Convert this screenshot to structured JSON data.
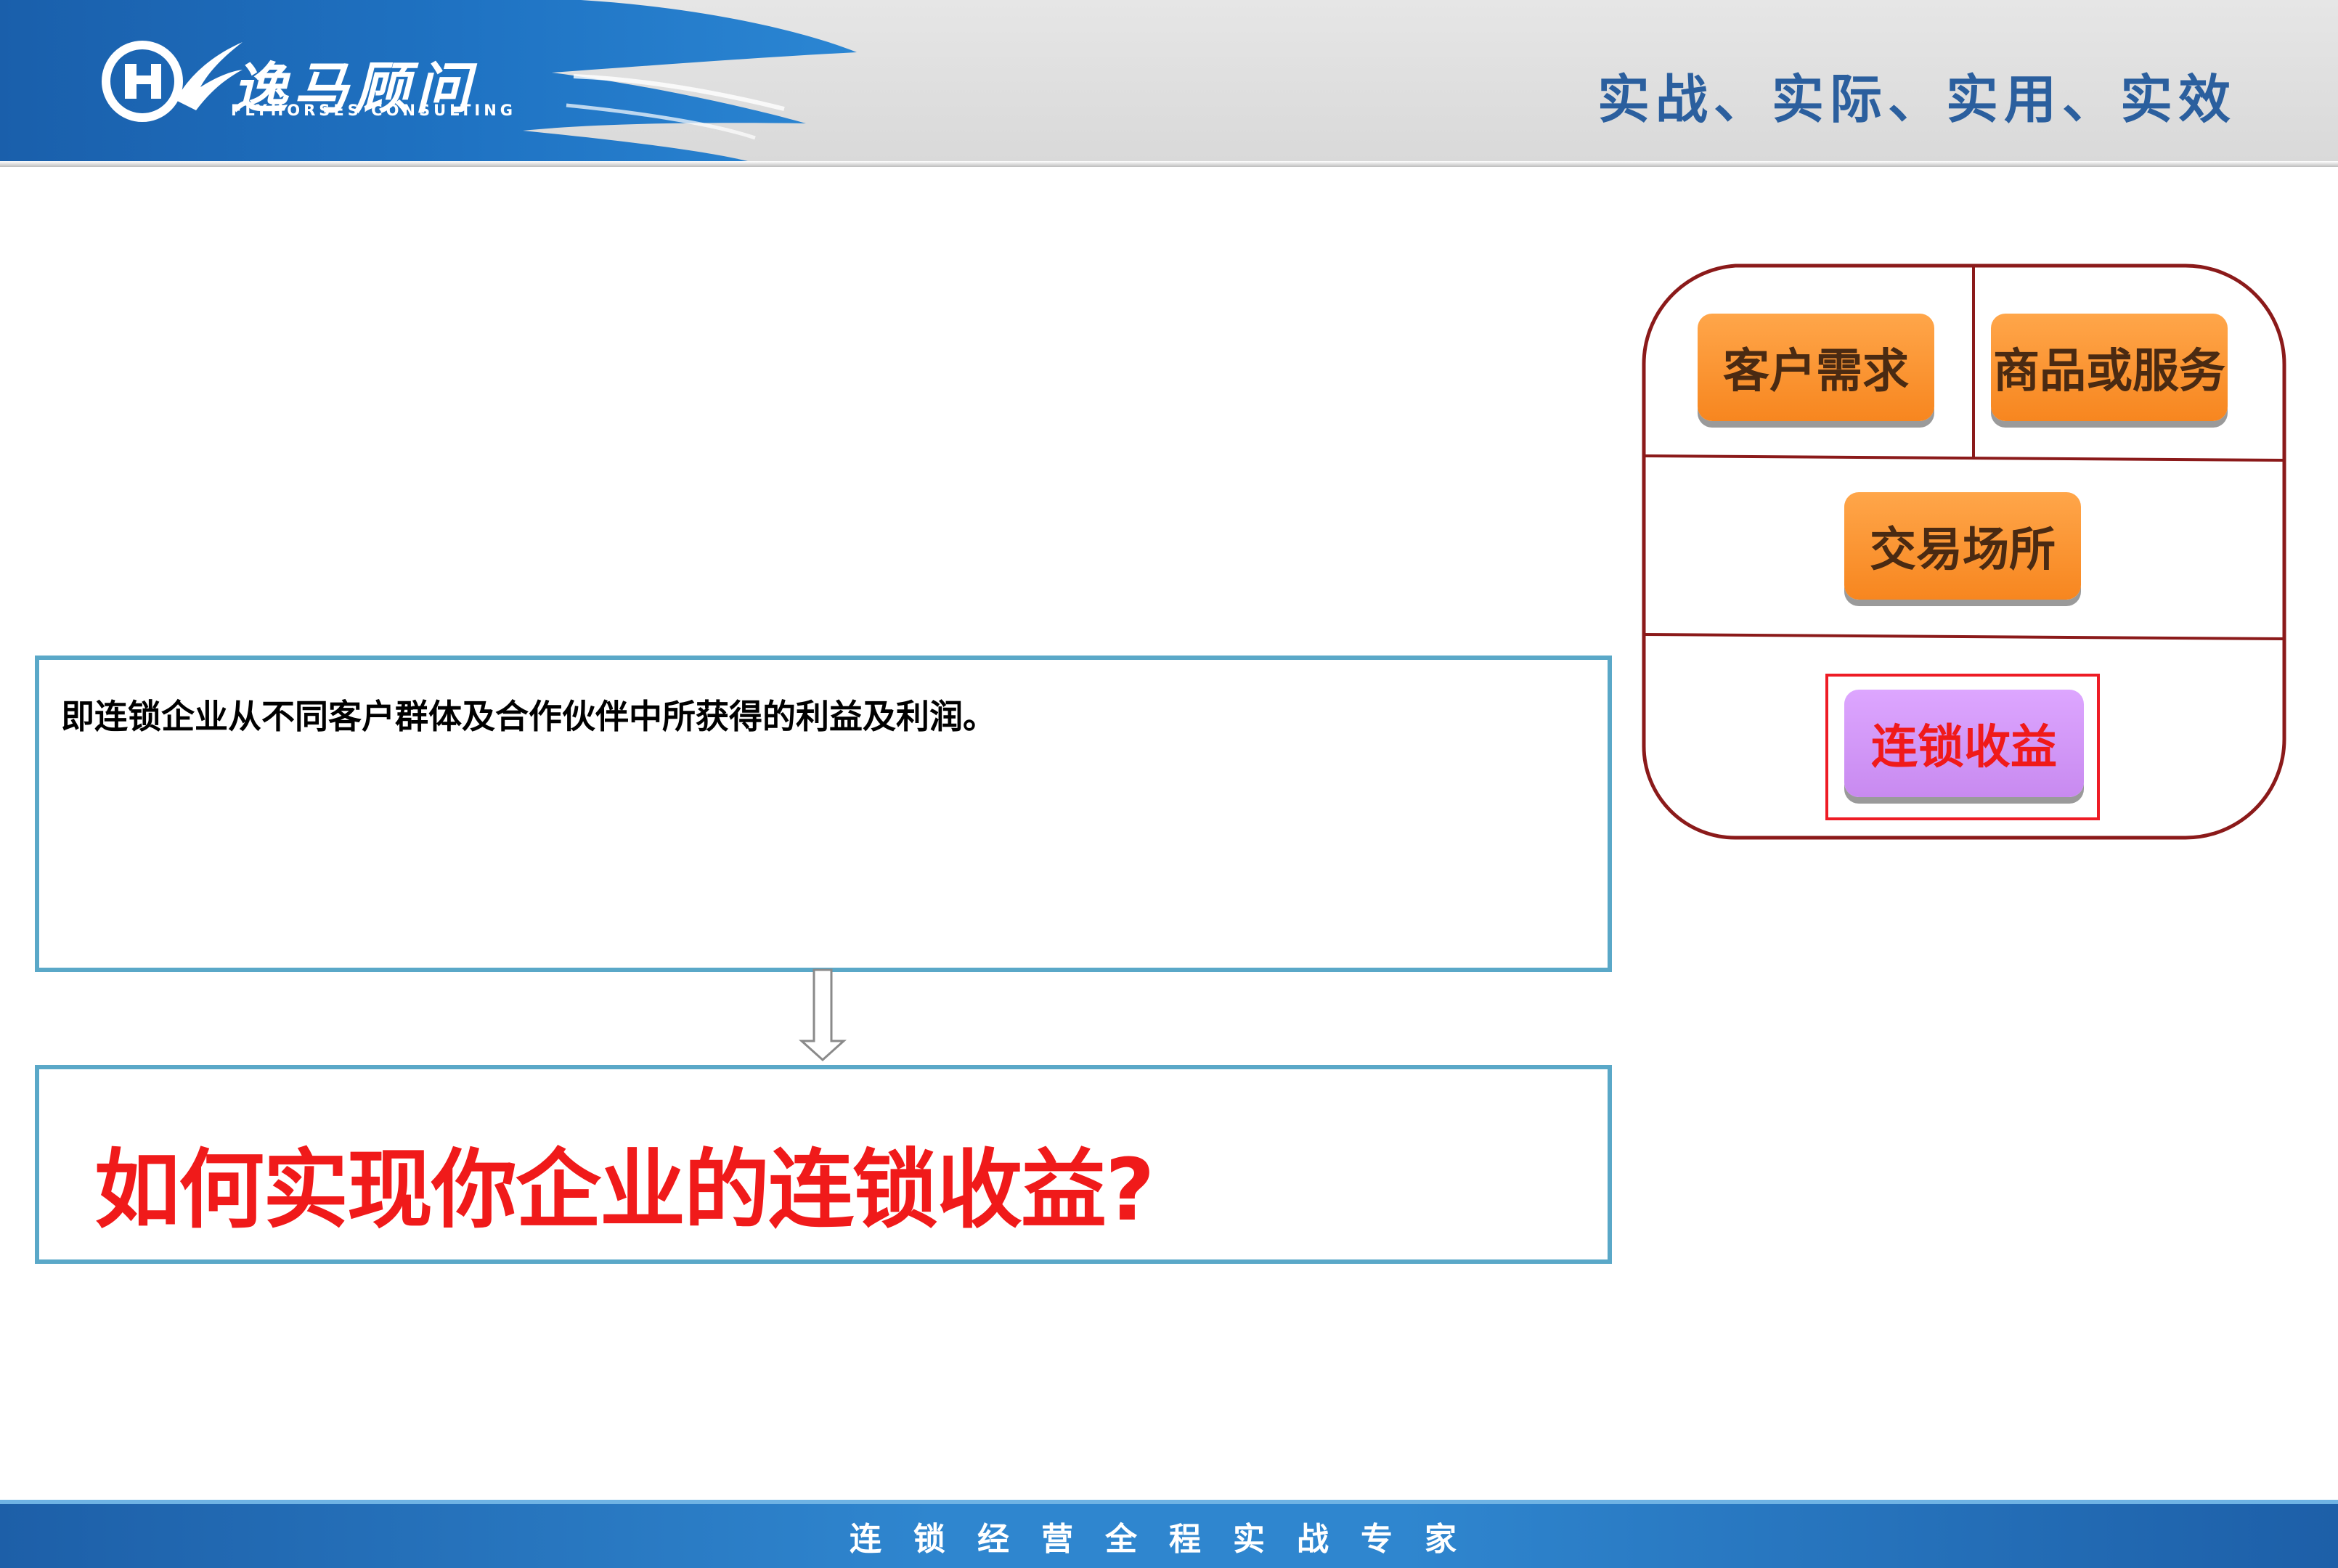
{
  "header": {
    "logo_cn": "逸马顾问",
    "logo_en": "FLYHORSES CONSULTING",
    "slogan": "实战、实际、实用、实效",
    "accent_color": "#1d6ab4"
  },
  "definition": {
    "text": "即连锁企业从不同客户群体及合作伙伴中所获得的利益及利润。"
  },
  "question": {
    "text": "如何实现你企业的连锁收益?",
    "color": "#f01a1a"
  },
  "diagram": {
    "customer_demand": "客户需求",
    "goods_services": "商品或服务",
    "trading_venue": "交易场所",
    "chain_revenue": "连锁收益",
    "chip_color": "#f7861f",
    "highlight_color": "#c88af0"
  },
  "footer": {
    "text": "连锁经营全程实战专家"
  }
}
